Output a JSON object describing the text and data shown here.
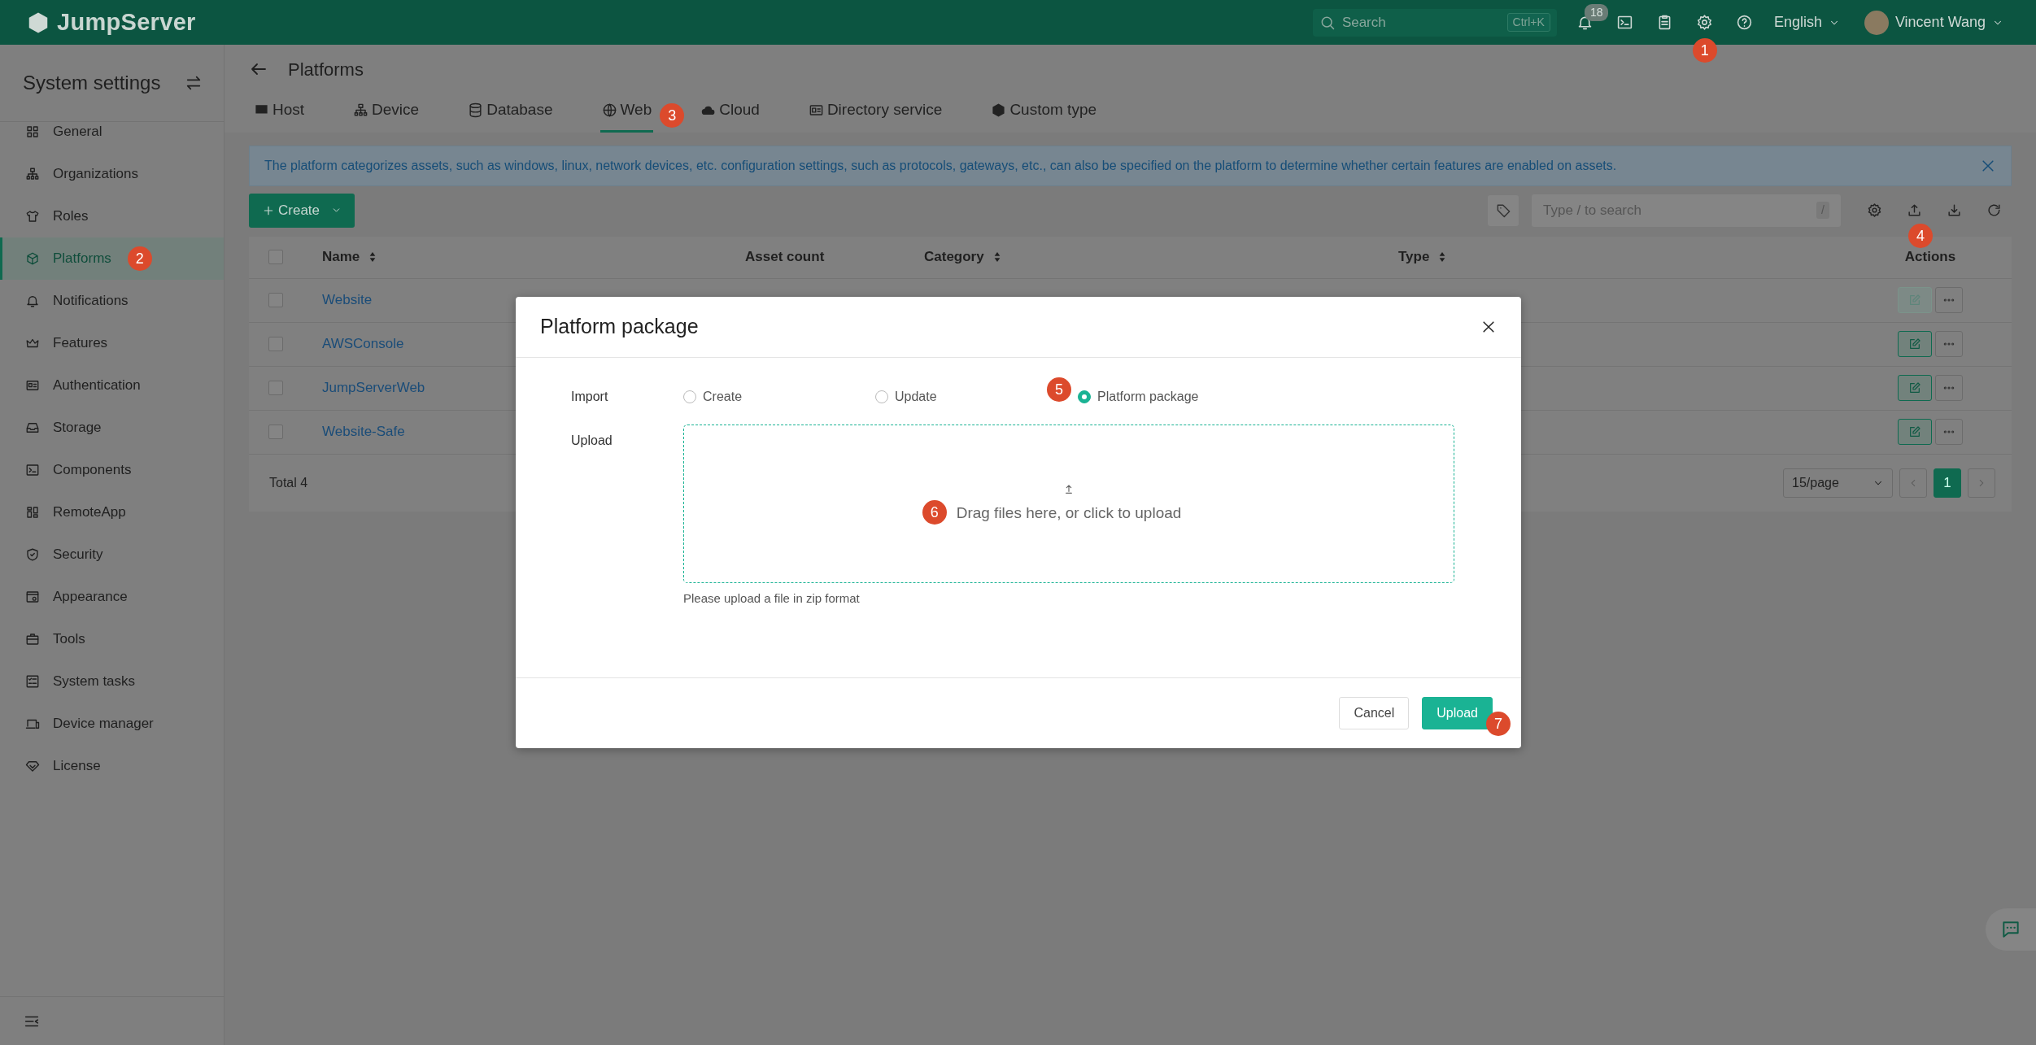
{
  "app": {
    "logo": "JumpServer"
  },
  "topbar": {
    "search": {
      "placeholder": "Search",
      "shortcut": "Ctrl+K"
    },
    "icons": [
      {
        "kind": "bell",
        "badge": "18"
      },
      {
        "kind": "terminal"
      },
      {
        "kind": "clipboard"
      },
      {
        "kind": "gear",
        "marker": "1"
      },
      {
        "kind": "help"
      }
    ],
    "language": "English",
    "user": "Vincent Wang"
  },
  "sidebar": {
    "title": "System settings",
    "items": [
      {
        "label": "General",
        "kind": "grid",
        "selected": false
      },
      {
        "label": "Organizations",
        "kind": "org",
        "selected": false
      },
      {
        "label": "Roles",
        "kind": "shirt",
        "selected": false
      },
      {
        "label": "Platforms",
        "kind": "cube",
        "selected": true,
        "marker": "2"
      },
      {
        "label": "Notifications",
        "kind": "bell",
        "selected": false
      },
      {
        "label": "Features",
        "kind": "crown",
        "selected": false
      },
      {
        "label": "Authentication",
        "kind": "idcard",
        "selected": false
      },
      {
        "label": "Storage",
        "kind": "drive",
        "selected": false
      },
      {
        "label": "Components",
        "kind": "terminal",
        "selected": false
      },
      {
        "label": "RemoteApp",
        "kind": "apps",
        "selected": false
      },
      {
        "label": "Security",
        "kind": "shield",
        "selected": false
      },
      {
        "label": "Appearance",
        "kind": "window",
        "selected": false
      },
      {
        "label": "Tools",
        "kind": "briefcase",
        "selected": false
      },
      {
        "label": "System tasks",
        "kind": "tasks",
        "selected": false
      },
      {
        "label": "Device manager",
        "kind": "devices",
        "selected": false
      },
      {
        "label": "License",
        "kind": "diamond",
        "selected": false
      }
    ]
  },
  "page": {
    "title": "Platforms",
    "tabs": [
      {
        "label": "Host",
        "kind": "monitor",
        "selected": false
      },
      {
        "label": "Device",
        "kind": "network",
        "selected": false
      },
      {
        "label": "Database",
        "kind": "database",
        "selected": false
      },
      {
        "label": "Web",
        "kind": "globe",
        "selected": true,
        "marker": "3"
      },
      {
        "label": "Cloud",
        "kind": "cloud",
        "selected": false
      },
      {
        "label": "Directory service",
        "kind": "card",
        "selected": false
      },
      {
        "label": "Custom type",
        "kind": "box",
        "selected": false
      }
    ],
    "alert": "The platform categorizes assets, such as windows, linux, network devices, etc. configuration settings, such as protocols, gateways, etc., can also be specified on the platform to determine whether certain features are enabled on assets.",
    "create_button": "Create",
    "search": {
      "placeholder": "Type / to search",
      "shortcut": "/"
    },
    "tools": [
      {
        "kind": "gear"
      },
      {
        "kind": "upload",
        "marker": "4"
      },
      {
        "kind": "download"
      },
      {
        "kind": "refresh"
      }
    ],
    "table": {
      "all_checked": false,
      "columns": [
        {
          "label": "Name",
          "sortable": true
        },
        {
          "label": "Asset count",
          "sortable": false
        },
        {
          "label": "Category",
          "sortable": true
        },
        {
          "label": "Type",
          "sortable": true
        },
        {
          "label": "Actions",
          "sortable": false
        }
      ],
      "rows": [
        {
          "name": "Website",
          "checked": false,
          "edit_disabled": true
        },
        {
          "name": "AWSConsole",
          "checked": false,
          "edit_disabled": false
        },
        {
          "name": "JumpServerWeb",
          "checked": false,
          "edit_disabled": false
        },
        {
          "name": "Website-Safe",
          "checked": false,
          "edit_disabled": false
        }
      ]
    },
    "total": "Total 4",
    "page_size": "15/page",
    "pages": [
      {
        "label": "1",
        "selected": true
      }
    ]
  },
  "dialog": {
    "title": "Platform package",
    "import_label": "Import",
    "options": [
      {
        "label": "Create",
        "selected": false
      },
      {
        "label": "Update",
        "selected": false
      },
      {
        "label": "Platform package",
        "selected": true,
        "marker": "5"
      }
    ],
    "upload_label": "Upload",
    "dropzone_text": "Drag files here, or click to upload",
    "dropzone_marker": "6",
    "hint": "Please upload a file in zip format",
    "buttons": [
      {
        "label": "Cancel",
        "kind": "secondary"
      },
      {
        "label": "Upload",
        "kind": "primary",
        "marker": "7"
      }
    ]
  }
}
